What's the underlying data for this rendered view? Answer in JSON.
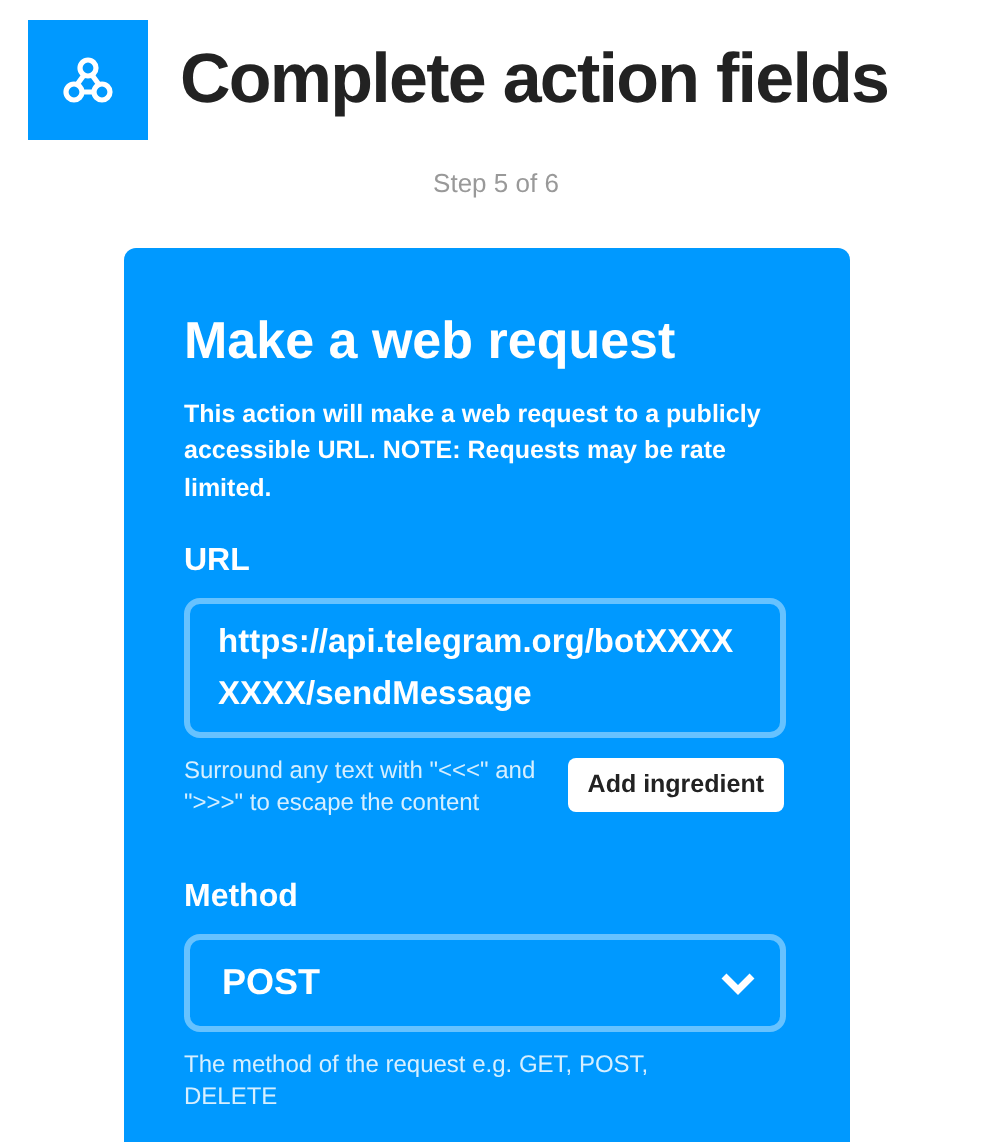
{
  "header": {
    "title": "Complete action fields",
    "step": "Step 5 of 6"
  },
  "card": {
    "title": "Make a web request",
    "description": "This action will make a web request to a publicly accessible URL. NOTE: Requests may be rate limited.",
    "fields": [
      {
        "kind": "text",
        "label": "URL",
        "value": "https://api.telegram.org/botXXXXXXXX/sendMessage",
        "help": "Surround any text with \"<<<\" and \">>>\" to escape the content",
        "button": "Add ingredient"
      },
      {
        "kind": "select",
        "label": "Method",
        "value": "POST",
        "help": "The method of the request e.g. GET, POST, DELETE"
      }
    ]
  }
}
